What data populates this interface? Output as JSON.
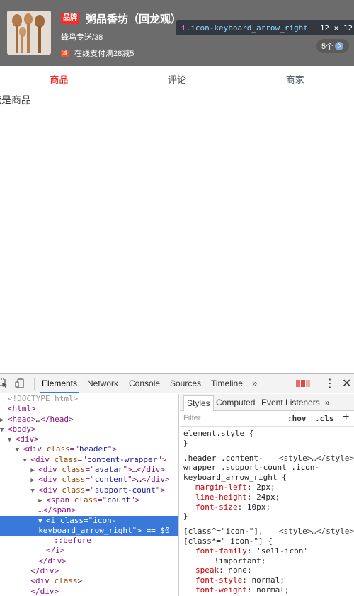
{
  "header": {
    "brand_tag": "品牌",
    "shop_name": "粥品香坊（回龙观）",
    "delivery": "蜂鸟专送/38",
    "support_icon": "减",
    "support_text": "在线支付满28减5",
    "support_count": "5个"
  },
  "inspect_tooltip": {
    "tag": "i",
    "class": ".icon-keyboard_arrow_right",
    "dims": "12 × 12"
  },
  "tabs": [
    {
      "label": "商品",
      "active": true
    },
    {
      "label": "评论",
      "active": false
    },
    {
      "label": "商家",
      "active": false
    }
  ],
  "content_text": "我是商品",
  "devtools": {
    "tabs": [
      "Elements",
      "Network",
      "Console",
      "Sources",
      "Timeline"
    ],
    "more": "»",
    "kebab": "⋮",
    "close": "✕",
    "elements_lines": [
      {
        "indent": 0,
        "arrow": "",
        "parts": [
          [
            "cm",
            "<!DOCTYPE html>"
          ]
        ]
      },
      {
        "indent": 0,
        "arrow": "",
        "parts": [
          [
            "t",
            "<html>"
          ]
        ]
      },
      {
        "indent": 0,
        "arrow": "▶",
        "parts": [
          [
            "t",
            "<head>"
          ],
          [
            "txt",
            "…"
          ],
          [
            "t",
            "</head>"
          ]
        ]
      },
      {
        "indent": 0,
        "arrow": "▼",
        "parts": [
          [
            "t",
            "<body>"
          ]
        ]
      },
      {
        "indent": 1,
        "arrow": "▼",
        "parts": [
          [
            "t",
            "<div>"
          ]
        ]
      },
      {
        "indent": 2,
        "arrow": "▼",
        "parts": [
          [
            "t",
            "<div "
          ],
          [
            "an",
            "class"
          ],
          [
            "t",
            "=\""
          ],
          [
            "av",
            "header"
          ],
          [
            "t",
            "\">"
          ]
        ]
      },
      {
        "indent": 3,
        "arrow": "▼",
        "parts": [
          [
            "t",
            "<div "
          ],
          [
            "an",
            "class"
          ],
          [
            "t",
            "=\""
          ],
          [
            "av",
            "content-wrapper"
          ],
          [
            "t",
            "\">"
          ]
        ]
      },
      {
        "indent": 4,
        "arrow": "▶",
        "parts": [
          [
            "t",
            "<div "
          ],
          [
            "an",
            "class"
          ],
          [
            "t",
            "=\""
          ],
          [
            "av",
            "avatar"
          ],
          [
            "t",
            "\">"
          ],
          [
            "txt",
            "…"
          ],
          [
            "t",
            "</div>"
          ]
        ]
      },
      {
        "indent": 4,
        "arrow": "▶",
        "parts": [
          [
            "t",
            "<div "
          ],
          [
            "an",
            "class"
          ],
          [
            "t",
            "=\""
          ],
          [
            "av",
            "content"
          ],
          [
            "t",
            "\">"
          ],
          [
            "txt",
            "…"
          ],
          [
            "t",
            "</div>"
          ]
        ]
      },
      {
        "indent": 4,
        "arrow": "▼",
        "parts": [
          [
            "t",
            "<div "
          ],
          [
            "an",
            "class"
          ],
          [
            "t",
            "=\""
          ],
          [
            "av",
            "support-count"
          ],
          [
            "t",
            "\">"
          ]
        ]
      },
      {
        "indent": 5,
        "arrow": "▶",
        "parts": [
          [
            "t",
            "<span "
          ],
          [
            "an",
            "class"
          ],
          [
            "t",
            "=\""
          ],
          [
            "av",
            "count"
          ],
          [
            "t",
            "\">"
          ]
        ]
      },
      {
        "indent": 4,
        "arrow": "",
        "parts": [
          [
            "txt",
            "…"
          ],
          [
            "t",
            "</span>"
          ]
        ]
      },
      {
        "indent": 5,
        "arrow": "▼",
        "sel": true,
        "parts": [
          [
            "t",
            "<i "
          ],
          [
            "an",
            "class"
          ],
          [
            "t",
            "=\""
          ],
          [
            "av",
            "icon-"
          ]
        ]
      },
      {
        "indent": 4,
        "arrow": "",
        "sel": true,
        "parts": [
          [
            "av",
            "keyboard_arrow_right"
          ],
          [
            "t",
            "\">"
          ],
          [
            "txt",
            " == $0"
          ]
        ]
      },
      {
        "indent": 6,
        "arrow": "",
        "parts": [
          [
            "ps",
            "::before"
          ]
        ]
      },
      {
        "indent": 5,
        "arrow": "",
        "parts": [
          [
            "t",
            "</i>"
          ]
        ]
      },
      {
        "indent": 4,
        "arrow": "",
        "parts": [
          [
            "t",
            "</div>"
          ]
        ]
      },
      {
        "indent": 3,
        "arrow": "",
        "parts": [
          [
            "t",
            "</div>"
          ]
        ]
      },
      {
        "indent": 3,
        "arrow": "",
        "parts": [
          [
            "t",
            "<div "
          ],
          [
            "an",
            "class"
          ],
          [
            "t",
            ">"
          ]
        ]
      },
      {
        "indent": 3,
        "arrow": "",
        "parts": [
          [
            "t",
            "</div>"
          ]
        ]
      }
    ],
    "styles_tabs": [
      "Styles",
      "Computed",
      "Event Listeners",
      "»"
    ],
    "filter_placeholder": "Filter",
    "hov": ":hov",
    "cls": ".cls",
    "plus": "+",
    "rules": [
      {
        "selector": "element.style {",
        "source": "",
        "props": [],
        "close": "}"
      },
      {
        "selector": ".header .content-\nwrapper .support-count .icon-\nkeyboard_arrow_right {",
        "source": "<style>…</style>",
        "props": [
          [
            "margin-left",
            "2px;"
          ],
          [
            "line-height",
            "24px;"
          ],
          [
            "font-size",
            "10px;"
          ]
        ],
        "close": "}"
      },
      {
        "selector": "[class^=\"icon-\"],\n[class*=\" icon-\"] {",
        "source": "<style>…</style>",
        "props": [
          [
            "font-family",
            "'sell-icon'\n    !important;"
          ],
          [
            "speak",
            "none;"
          ],
          [
            "font-style",
            "normal;"
          ],
          [
            "font-weight",
            "normal;"
          ]
        ],
        "close": ""
      }
    ]
  }
}
